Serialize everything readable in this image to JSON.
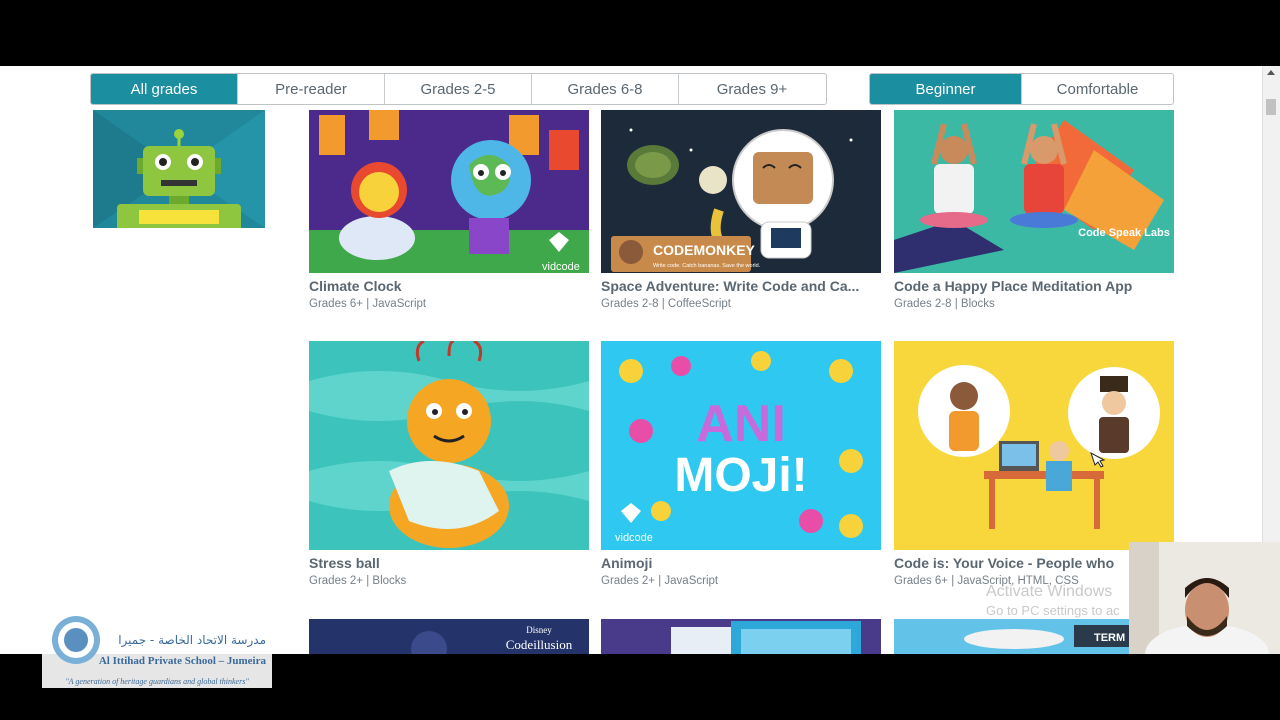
{
  "filters": {
    "grades": [
      {
        "label": "All grades",
        "active": true
      },
      {
        "label": "Pre-reader",
        "active": false
      },
      {
        "label": "Grades 2-5",
        "active": false
      },
      {
        "label": "Grades 6-8",
        "active": false
      },
      {
        "label": "Grades 9+",
        "active": false
      }
    ],
    "levels": [
      {
        "label": "Beginner",
        "active": true
      },
      {
        "label": "Comfortable",
        "active": false
      }
    ]
  },
  "cards": [
    {
      "title": "Climate Clock",
      "meta": "Grades 6+ | JavaScript",
      "brand": "vidcode"
    },
    {
      "title": "Space Adventure: Write Code and Ca...",
      "meta": "Grades 2-8 | CoffeeScript",
      "brand": "CODEMONKEY",
      "brand_sub": "Write code. Catch bananas. Save the world."
    },
    {
      "title": "Code a Happy Place Meditation App",
      "meta": "Grades 2-8 | Blocks",
      "brand": "Code Speak Labs"
    },
    {
      "title": "Stress ball",
      "meta": "Grades 2+ | Blocks"
    },
    {
      "title": "Animoji",
      "meta": "Grades 2+ | JavaScript",
      "brand": "vidcode",
      "art_text_1": "ANI",
      "art_text_2": "MOJi!"
    },
    {
      "title": "Code is: Your Voice - People who",
      "meta": "Grades 6+ | JavaScript, HTML, CSS"
    }
  ],
  "bottom_row": {
    "disney_label": "Disney",
    "codeillusion_label": "Codeillusion",
    "term_label": "TERM"
  },
  "watermark": {
    "line1": "Activate Windows",
    "line2": "Go to PC settings to ac"
  },
  "school": {
    "arabic": "مدرسة الاتحاد الخاصة - جميرا",
    "english": "Al Ittihad Private School – Jumeira",
    "tagline": "\"A generation of heritage guardians and global thinkers\""
  },
  "colors": {
    "accent": "#1b8ea0",
    "text": "#5b6770"
  }
}
